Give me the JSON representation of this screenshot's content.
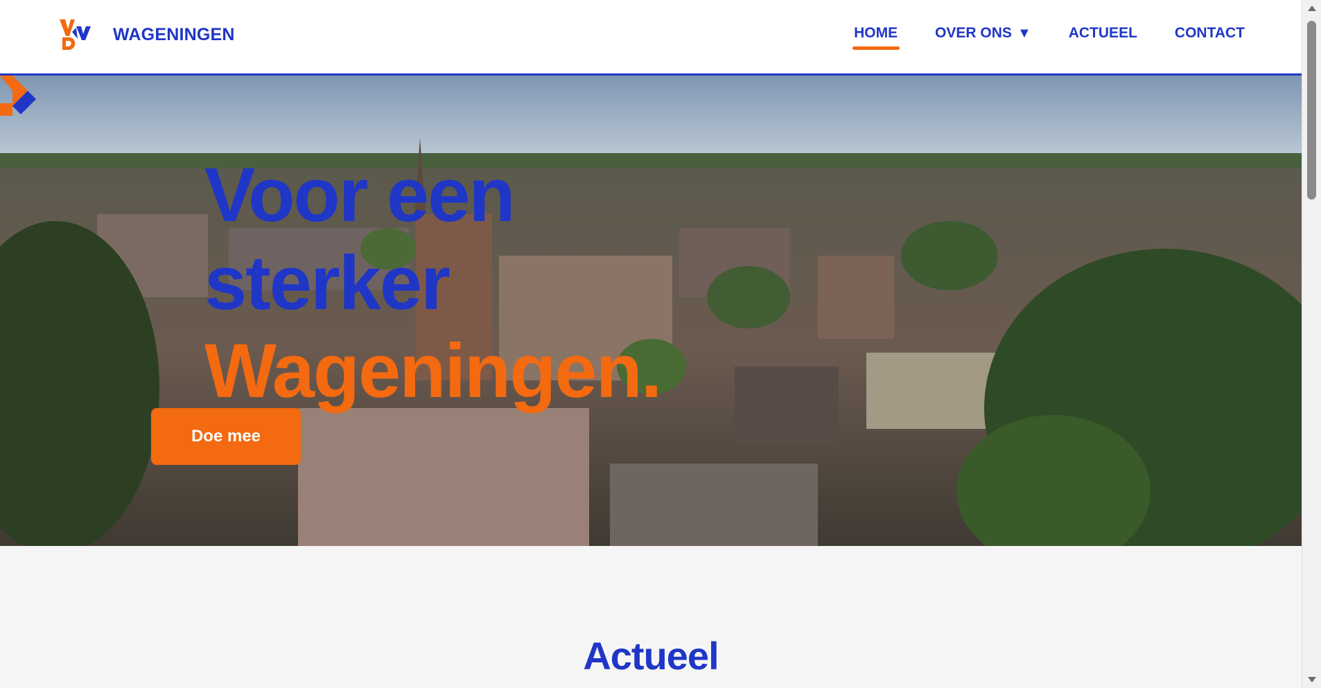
{
  "header": {
    "logo_alt": "VVD",
    "site_title": "WAGENINGEN",
    "nav": [
      {
        "label": "HOME",
        "active": true
      },
      {
        "label": "OVER ONS",
        "caret": "▼"
      },
      {
        "label": "ACTUEEL"
      },
      {
        "label": "CONTACT"
      }
    ]
  },
  "hero": {
    "line1": "Voor een",
    "line2": "sterker",
    "line3": "Wageningen.",
    "cta_label": "Doe mee"
  },
  "section": {
    "title": "Actueel"
  },
  "colors": {
    "brand_blue": "#1f36c7",
    "brand_orange": "#f36a10"
  }
}
